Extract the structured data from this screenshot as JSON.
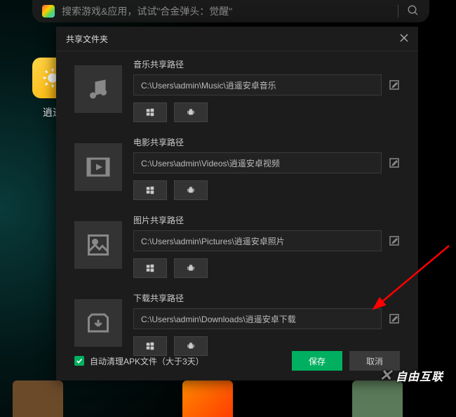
{
  "search": {
    "placeholder": "搜索游戏&应用，试试\"合金弹头：觉醒\""
  },
  "appicon_label": "逍遥",
  "dialog": {
    "title": "共享文件夹",
    "rows": [
      {
        "label": "音乐共享路径",
        "path": "C:\\Users\\admin\\Music\\逍遥安卓音乐",
        "icon": "music"
      },
      {
        "label": "电影共享路径",
        "path": "C:\\Users\\admin\\Videos\\逍遥安卓视频",
        "icon": "video"
      },
      {
        "label": "图片共享路径",
        "path": "C:\\Users\\admin\\Pictures\\逍遥安卓照片",
        "icon": "image"
      },
      {
        "label": "下载共享路径",
        "path": "C:\\Users\\admin\\Downloads\\逍遥安卓下载",
        "icon": "download"
      }
    ],
    "auto_clean_label": "自动清理APK文件（大于3天）",
    "auto_clean_checked": true,
    "save_label": "保存",
    "cancel_label": "取消"
  },
  "watermark": "自由互联"
}
